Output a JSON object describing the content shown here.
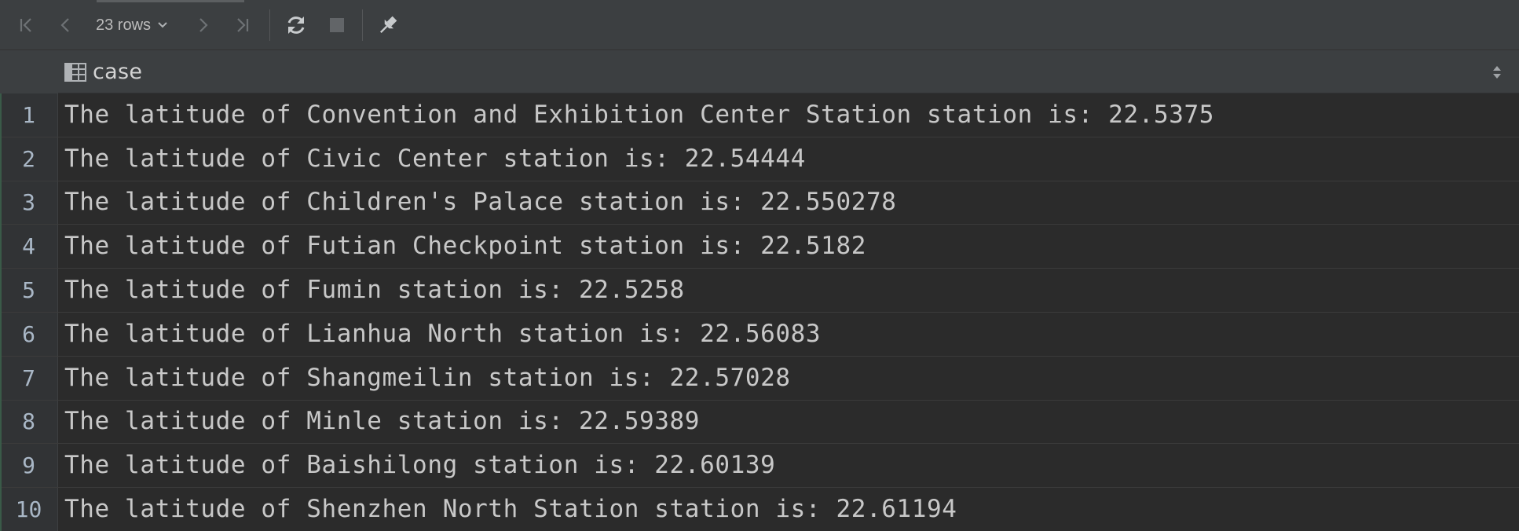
{
  "toolbar": {
    "rows_label": "23 rows",
    "icons": [
      "first-page-icon",
      "previous-page-icon",
      "chevron-down-icon",
      "next-page-icon",
      "last-page-icon",
      "refresh-icon",
      "stop-icon",
      "pin-icon"
    ]
  },
  "table": {
    "column_header": "case",
    "rows": [
      {
        "num": "1",
        "value": "The latitude of Convention and Exhibition Center Station station is: 22.5375"
      },
      {
        "num": "2",
        "value": "The latitude of Civic Center station is: 22.54444"
      },
      {
        "num": "3",
        "value": "The latitude of Children's Palace station is: 22.550278"
      },
      {
        "num": "4",
        "value": "The latitude of Futian Checkpoint station is: 22.5182"
      },
      {
        "num": "5",
        "value": "The latitude of Fumin station is: 22.5258"
      },
      {
        "num": "6",
        "value": "The latitude of Lianhua North station is: 22.56083"
      },
      {
        "num": "7",
        "value": "The latitude of Shangmeilin station is: 22.57028"
      },
      {
        "num": "8",
        "value": "The latitude of Minle station is: 22.59389"
      },
      {
        "num": "9",
        "value": "The latitude of Baishilong station is: 22.60139"
      },
      {
        "num": "10",
        "value": "The latitude of Shenzhen North Station station is: 22.61194"
      }
    ]
  },
  "colors": {
    "background": "#2b2b2b",
    "toolbar": "#3c3f41",
    "text": "#c8c8c8",
    "row_number": "#a9b7c6"
  }
}
